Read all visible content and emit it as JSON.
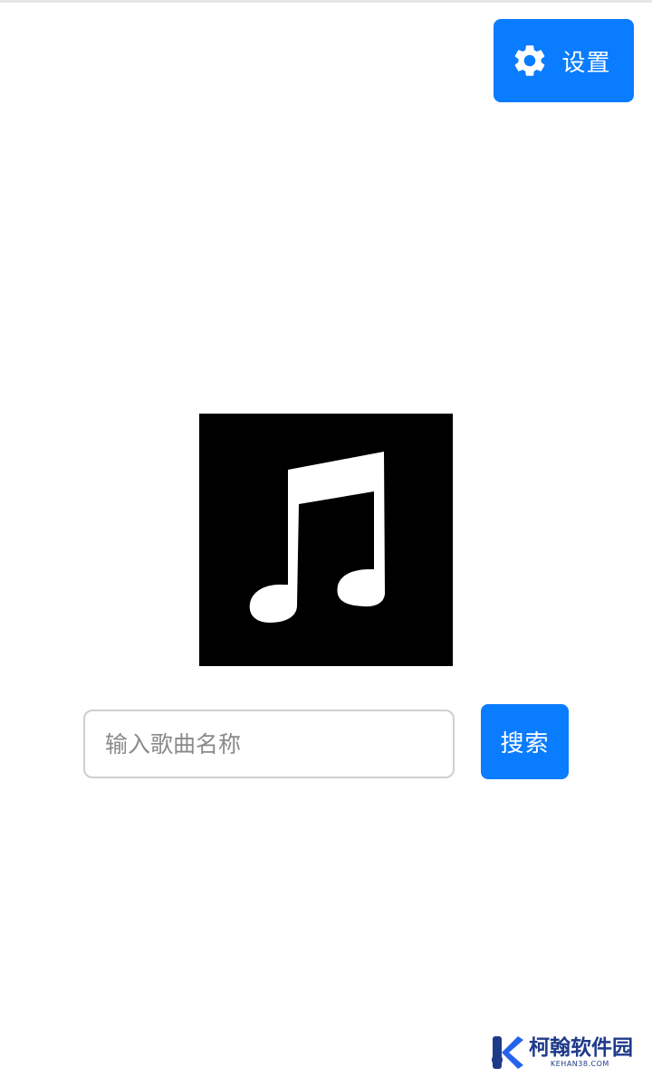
{
  "header": {
    "settings_label": "设置",
    "settings_icon": "gear-icon"
  },
  "player": {
    "album_art_icon": "music-note-icon"
  },
  "search": {
    "placeholder": "输入歌曲名称",
    "value": "",
    "button_label": "搜索"
  },
  "watermark": {
    "text": "柯翰软件园",
    "domain": "KEHAN38.COM"
  },
  "colors": {
    "accent": "#0a7cff",
    "background": "#ffffff",
    "album_bg": "#000000",
    "input_border": "#cfcfcf",
    "placeholder": "#8a8a8a",
    "watermark": "#1e3a8a"
  }
}
